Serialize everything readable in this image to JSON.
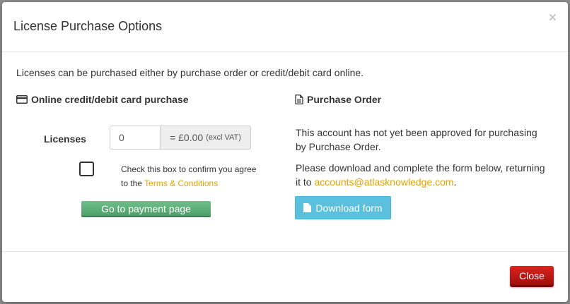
{
  "modal": {
    "title": "License Purchase Options",
    "close_x": "×",
    "intro": "Licenses can be purchased either by purchase order or credit/debit card online."
  },
  "online": {
    "heading": "Online credit/debit card purchase",
    "heading_icon": "credit-card-icon",
    "licenses_label": "Licenses",
    "licenses_value": "0",
    "price_text": "= £0.00",
    "price_note": "(excl VAT)",
    "checkbox_checked": false,
    "terms_text": "Check this box to confirm you agree to the",
    "terms_link": "Terms & Conditions",
    "pay_button": "Go to payment page"
  },
  "purchase_order": {
    "heading": "Purchase Order",
    "heading_icon": "document-icon",
    "not_approved": "This account has not yet been approved for purchasing by Purchase Order.",
    "instructions": "Please download and complete the form below, returning it to",
    "email": "accounts@atlasknowledge.com",
    "instructions_end": ".",
    "download_button": "Download form",
    "download_icon": "file-icon"
  },
  "footer": {
    "close_button": "Close"
  },
  "colors": {
    "link": "#e8a200",
    "pay_button": "#5aae78",
    "download_button": "#5bc0de",
    "close_button": "#c41a16"
  }
}
